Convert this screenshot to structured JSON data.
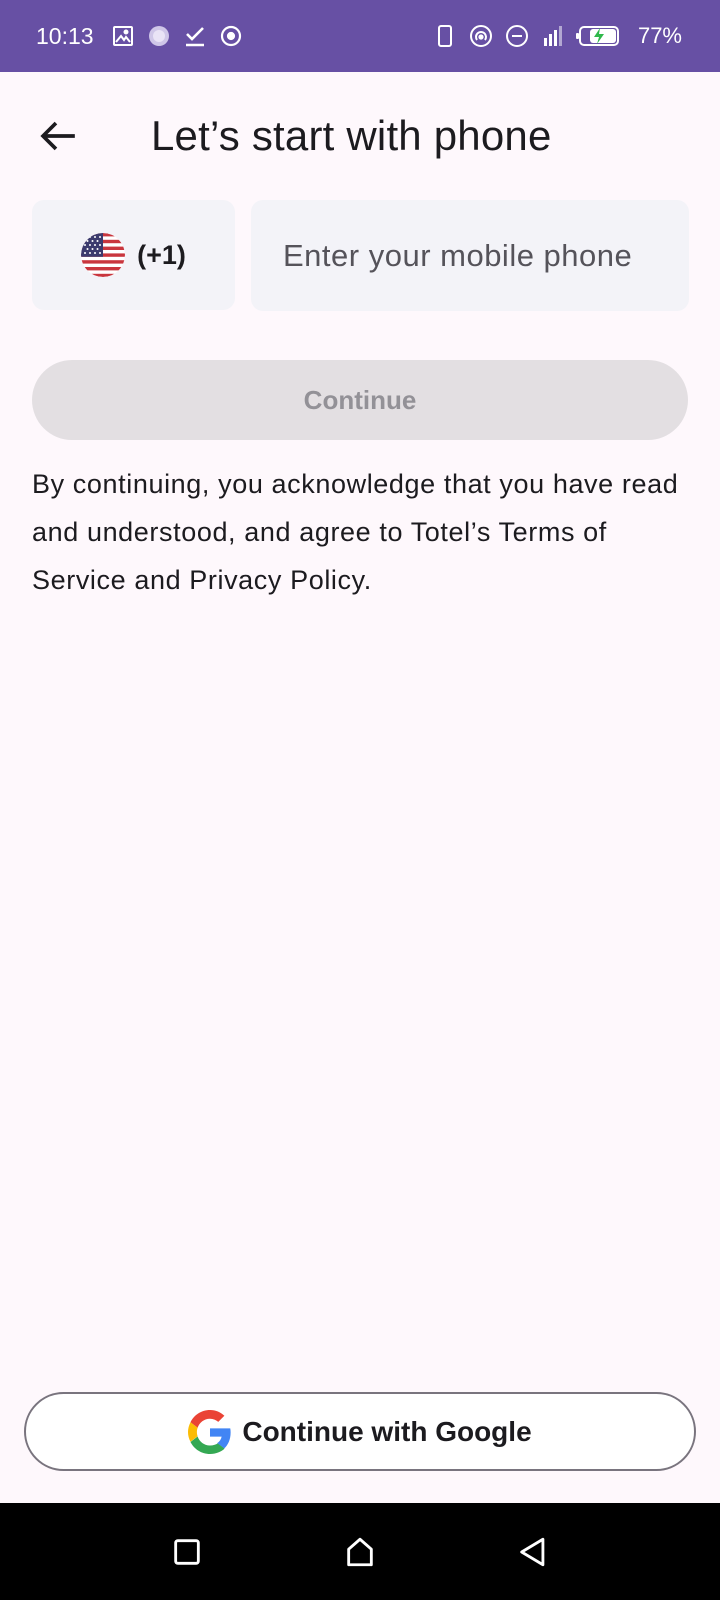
{
  "status_bar": {
    "time": "10:13",
    "battery_percent": "77%",
    "left_icons": [
      "image-icon",
      "sync-spinner-icon",
      "task-done-icon",
      "target-icon"
    ],
    "right_icons": [
      "phone-outline-icon",
      "hotspot-icon",
      "dnd-icon",
      "signal-icon",
      "battery-charging-icon"
    ],
    "color": "#6750A4"
  },
  "app_bar": {
    "back_icon": "arrow-left-icon",
    "title": "Let’s start with phone"
  },
  "phone_form": {
    "country_flag": "us-flag-icon",
    "dial_code": "(+1)",
    "phone_placeholder": "Enter your mobile phone",
    "phone_value": "",
    "continue_label": "Continue",
    "continue_enabled": false
  },
  "legal_text": "By continuing, you acknowledge that you have read and understood, and agree to Totel’s Terms of Service and Privacy Policy.",
  "google_button": {
    "icon": "google-icon",
    "label": "Continue with Google"
  },
  "nav_bar": {
    "recents_icon": "square-icon",
    "home_icon": "home-icon",
    "back_icon": "triangle-back-icon"
  }
}
